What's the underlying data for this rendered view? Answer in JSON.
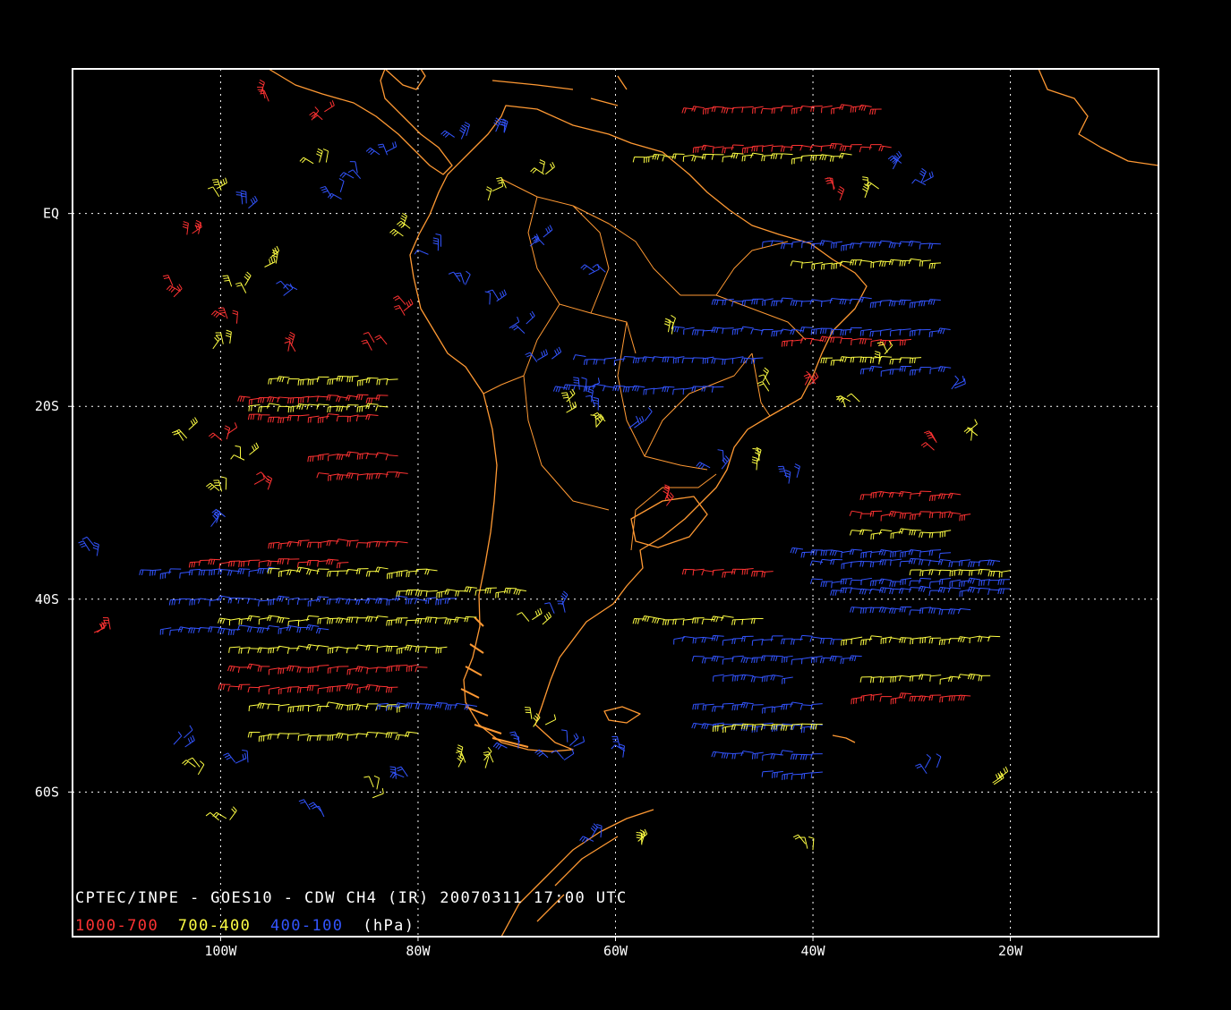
{
  "map": {
    "extent": {
      "lon_min": -115,
      "lon_max": -5,
      "lat_min": -75,
      "lat_max": 15
    },
    "grid": {
      "style": "dotted",
      "lon_step": 20,
      "lat_step": 20
    },
    "x_ticks": [
      {
        "lon": -100,
        "label": "100W"
      },
      {
        "lon": -80,
        "label": "80W"
      },
      {
        "lon": -60,
        "label": "60W"
      },
      {
        "lon": -40,
        "label": "40W"
      },
      {
        "lon": -20,
        "label": "20W"
      }
    ],
    "y_ticks": [
      {
        "lat": 0,
        "label": "EQ"
      },
      {
        "lat": -20,
        "label": "20S"
      },
      {
        "lat": -40,
        "label": "40S"
      },
      {
        "lat": -60,
        "label": "60S"
      }
    ],
    "colors": {
      "background": "#000000",
      "frame": "#ffffff",
      "grid": "#ffffff",
      "coastline": "#ff9933",
      "low_level": "#ff3333",
      "mid_level": "#ffff44",
      "high_level": "#3355ff",
      "title": "#ffffff"
    }
  },
  "title": "CPTEC/INPE - GOES10 - CDW CH4 (IR) 20070311 17:00 UTC",
  "legend": {
    "items": [
      {
        "label": "1000-700",
        "color": "#ff3333"
      },
      {
        "label": "700-400",
        "color": "#ffff44"
      },
      {
        "label": "400-100",
        "color": "#3355ff"
      }
    ],
    "unit": "(hPa)"
  },
  "wind_bands": [
    {
      "layer": "high",
      "lat": -12,
      "lon_start": -54,
      "lon_end": -27
    },
    {
      "layer": "high",
      "lat": -9,
      "lon_start": -50,
      "lon_end": -28
    },
    {
      "layer": "high",
      "lat": -3,
      "lon_start": -45,
      "lon_end": -28
    },
    {
      "layer": "mid",
      "lat": -5,
      "lon_start": -42,
      "lon_end": -28
    },
    {
      "layer": "high",
      "lat": -15,
      "lon_start": -64,
      "lon_end": -46
    },
    {
      "layer": "high",
      "lat": -18,
      "lon_start": -66,
      "lon_end": -50
    },
    {
      "layer": "mid",
      "lat": 6,
      "lon_start": -58,
      "lon_end": -37
    },
    {
      "layer": "low",
      "lat": 11,
      "lon_start": -53,
      "lon_end": -34
    },
    {
      "layer": "low",
      "lat": 7,
      "lon_start": -52,
      "lon_end": -33
    },
    {
      "layer": "mid",
      "lat": -17,
      "lon_start": -95,
      "lon_end": -83
    },
    {
      "layer": "low",
      "lat": -19,
      "lon_start": -98,
      "lon_end": -84
    },
    {
      "layer": "low",
      "lat": -21,
      "lon_start": -97,
      "lon_end": -85
    },
    {
      "layer": "mid",
      "lat": -20,
      "lon_start": -97,
      "lon_end": -84
    },
    {
      "layer": "low",
      "lat": -25,
      "lon_start": -91,
      "lon_end": -83
    },
    {
      "layer": "low",
      "lat": -27,
      "lon_start": -90,
      "lon_end": -82
    },
    {
      "layer": "low",
      "lat": -34,
      "lon_start": -95,
      "lon_end": -82
    },
    {
      "layer": "low",
      "lat": -36,
      "lon_start": -103,
      "lon_end": -88
    },
    {
      "layer": "high",
      "lat": -37,
      "lon_start": -108,
      "lon_end": -95
    },
    {
      "layer": "mid",
      "lat": -37,
      "lon_start": -95,
      "lon_end": -79
    },
    {
      "layer": "high",
      "lat": -40,
      "lon_start": -105,
      "lon_end": -77
    },
    {
      "layer": "mid",
      "lat": -39,
      "lon_start": -82,
      "lon_end": -70
    },
    {
      "layer": "mid",
      "lat": -42,
      "lon_start": -100,
      "lon_end": -75
    },
    {
      "layer": "high",
      "lat": -43,
      "lon_start": -106,
      "lon_end": -90
    },
    {
      "layer": "mid",
      "lat": -45,
      "lon_start": -99,
      "lon_end": -78
    },
    {
      "layer": "low",
      "lat": -47,
      "lon_start": -99,
      "lon_end": -80
    },
    {
      "layer": "low",
      "lat": -49,
      "lon_start": -100,
      "lon_end": -83
    },
    {
      "layer": "mid",
      "lat": -51,
      "lon_start": -97,
      "lon_end": -82
    },
    {
      "layer": "high",
      "lat": -51,
      "lon_start": -84,
      "lon_end": -75
    },
    {
      "layer": "mid",
      "lat": -54,
      "lon_start": -97,
      "lon_end": -81
    },
    {
      "layer": "high",
      "lat": -35,
      "lon_start": -42,
      "lon_end": -27
    },
    {
      "layer": "high",
      "lat": -36,
      "lon_start": -40,
      "lon_end": -22
    },
    {
      "layer": "high",
      "lat": -38,
      "lon_start": -40,
      "lon_end": -21
    },
    {
      "layer": "mid",
      "lat": -37,
      "lon_start": -30,
      "lon_end": -21
    },
    {
      "layer": "high",
      "lat": -39,
      "lon_start": -38,
      "lon_end": -21
    },
    {
      "layer": "high",
      "lat": -41,
      "lon_start": -36,
      "lon_end": -25
    },
    {
      "layer": "mid",
      "lat": -42,
      "lon_start": -58,
      "lon_end": -46
    },
    {
      "layer": "high",
      "lat": -44,
      "lon_start": -54,
      "lon_end": -38
    },
    {
      "layer": "mid",
      "lat": -44,
      "lon_start": -37,
      "lon_end": -22
    },
    {
      "layer": "high",
      "lat": -46,
      "lon_start": -52,
      "lon_end": -36
    },
    {
      "layer": "high",
      "lat": -48,
      "lon_start": -50,
      "lon_end": -43
    },
    {
      "layer": "mid",
      "lat": -48,
      "lon_start": -35,
      "lon_end": -23
    },
    {
      "layer": "low",
      "lat": -50,
      "lon_start": -36,
      "lon_end": -25
    },
    {
      "layer": "high",
      "lat": -51,
      "lon_start": -52,
      "lon_end": -40
    },
    {
      "layer": "high",
      "lat": -53,
      "lon_start": -52,
      "lon_end": -40
    },
    {
      "layer": "mid",
      "lat": -53,
      "lon_start": -50,
      "lon_end": -40
    },
    {
      "layer": "high",
      "lat": -56,
      "lon_start": -50,
      "lon_end": -40
    },
    {
      "layer": "high",
      "lat": -58,
      "lon_start": -45,
      "lon_end": -40
    },
    {
      "layer": "low",
      "lat": -31,
      "lon_start": -36,
      "lon_end": -25
    },
    {
      "layer": "low",
      "lat": -29,
      "lon_start": -35,
      "lon_end": -26
    },
    {
      "layer": "mid",
      "lat": -33,
      "lon_start": -36,
      "lon_end": -27
    },
    {
      "layer": "low",
      "lat": -37,
      "lon_start": -53,
      "lon_end": -45
    },
    {
      "layer": "mid",
      "lat": -15,
      "lon_start": -39,
      "lon_end": -30
    },
    {
      "layer": "low",
      "lat": -13,
      "lon_start": -43,
      "lon_end": -31
    },
    {
      "layer": "high",
      "lat": -16,
      "lon_start": -35,
      "lon_end": -27
    }
  ],
  "wind_scatter": [
    {
      "layer": "high",
      "lat": 2,
      "lon": -88
    },
    {
      "layer": "high",
      "lat": 4,
      "lon": -86
    },
    {
      "layer": "high",
      "lat": 6,
      "lon": -84
    },
    {
      "layer": "mid",
      "lat": 5,
      "lon": -90
    },
    {
      "layer": "low",
      "lat": 10,
      "lon": -90
    },
    {
      "layer": "low",
      "lat": 12,
      "lon": -95
    },
    {
      "layer": "mid",
      "lat": 2,
      "lon": -100
    },
    {
      "layer": "high",
      "lat": 1,
      "lon": -97
    },
    {
      "layer": "low",
      "lat": -2,
      "lon": -103
    },
    {
      "layer": "mid",
      "lat": -5,
      "lon": -95
    },
    {
      "layer": "low",
      "lat": -8,
      "lon": -104
    },
    {
      "layer": "mid",
      "lat": -8,
      "lon": -98
    },
    {
      "layer": "high",
      "lat": -8,
      "lon": -93
    },
    {
      "layer": "low",
      "lat": -11,
      "lon": -99
    },
    {
      "layer": "mid",
      "lat": -14,
      "lon": -100
    },
    {
      "layer": "low",
      "lat": -14,
      "lon": -93
    },
    {
      "layer": "high",
      "lat": -4,
      "lon": -78
    },
    {
      "layer": "high",
      "lat": -7,
      "lon": -76
    },
    {
      "layer": "high",
      "lat": -9,
      "lon": -72
    },
    {
      "layer": "high",
      "lat": -12,
      "lon": -70
    },
    {
      "layer": "high",
      "lat": -15,
      "lon": -67
    },
    {
      "layer": "high",
      "lat": -18,
      "lon": -63
    },
    {
      "layer": "mid",
      "lat": -20,
      "lon": -64
    },
    {
      "layer": "high",
      "lat": -22,
      "lon": -58
    },
    {
      "layer": "mid",
      "lat": -22,
      "lon": -62
    },
    {
      "layer": "mid",
      "lat": -12,
      "lon": -54
    },
    {
      "layer": "high",
      "lat": -6,
      "lon": -62
    },
    {
      "layer": "high",
      "lat": -3,
      "lon": -68
    },
    {
      "layer": "mid",
      "lat": 2,
      "lon": -72
    },
    {
      "layer": "mid",
      "lat": 4,
      "lon": -68
    },
    {
      "layer": "high",
      "lat": 8,
      "lon": -76
    },
    {
      "layer": "high",
      "lat": 9,
      "lon": -72
    },
    {
      "layer": "mid",
      "lat": -2,
      "lon": -81
    },
    {
      "layer": "low",
      "lat": -10,
      "lon": -82
    },
    {
      "layer": "low",
      "lat": -14,
      "lon": -84
    },
    {
      "layer": "mid",
      "lat": -18,
      "lon": -45
    },
    {
      "layer": "low",
      "lat": -18,
      "lon": -40
    },
    {
      "layer": "mid",
      "lat": -20,
      "lon": -36
    },
    {
      "layer": "low",
      "lat": -24,
      "lon": -28
    },
    {
      "layer": "mid",
      "lat": -23,
      "lon": -24
    },
    {
      "layer": "high",
      "lat": -18,
      "lon": -25
    },
    {
      "layer": "mid",
      "lat": -15,
      "lon": -33
    },
    {
      "layer": "high",
      "lat": 5,
      "lon": -32
    },
    {
      "layer": "high",
      "lat": 3,
      "lon": -29
    },
    {
      "layer": "mid",
      "lat": 2,
      "lon": -34
    },
    {
      "layer": "low",
      "lat": 2,
      "lon": -38
    },
    {
      "layer": "high",
      "lat": -26,
      "lon": -50
    },
    {
      "layer": "mid",
      "lat": -26,
      "lon": -45
    },
    {
      "layer": "high",
      "lat": -28,
      "lon": -42
    },
    {
      "layer": "low",
      "lat": -30,
      "lon": -55
    },
    {
      "layer": "mid",
      "lat": -42,
      "lon": -68
    },
    {
      "layer": "high",
      "lat": -41,
      "lon": -66
    },
    {
      "layer": "mid",
      "lat": -53,
      "lon": -68
    },
    {
      "layer": "high",
      "lat": -55,
      "lon": -70
    },
    {
      "layer": "high",
      "lat": -55,
      "lon": -65
    },
    {
      "layer": "high",
      "lat": -56,
      "lon": -60
    },
    {
      "layer": "mid",
      "lat": -57,
      "lon": -76
    },
    {
      "layer": "mid",
      "lat": -57,
      "lon": -73
    },
    {
      "layer": "high",
      "lat": -57,
      "lon": -66
    },
    {
      "layer": "mid",
      "lat": -58,
      "lon": -103
    },
    {
      "layer": "high",
      "lat": -55,
      "lon": -104
    },
    {
      "layer": "high",
      "lat": -57,
      "lon": -98
    },
    {
      "layer": "mid",
      "lat": -63,
      "lon": -100
    },
    {
      "layer": "high",
      "lat": -62,
      "lon": -90
    },
    {
      "layer": "mid",
      "lat": -60,
      "lon": -85
    },
    {
      "layer": "high",
      "lat": -58,
      "lon": -82
    },
    {
      "layer": "mid",
      "lat": -65,
      "lon": -58
    },
    {
      "layer": "high",
      "lat": -65,
      "lon": -62
    },
    {
      "layer": "mid",
      "lat": -66,
      "lon": -40
    },
    {
      "layer": "high",
      "lat": -58,
      "lon": -28
    },
    {
      "layer": "mid",
      "lat": -59,
      "lon": -22
    },
    {
      "layer": "high",
      "lat": -35,
      "lon": -113
    },
    {
      "layer": "low",
      "lat": -43,
      "lon": -112
    },
    {
      "layer": "high",
      "lat": -32,
      "lon": -100
    },
    {
      "layer": "mid",
      "lat": -29,
      "lon": -100
    },
    {
      "layer": "low",
      "lat": -28,
      "lon": -96
    },
    {
      "layer": "mid",
      "lat": -23,
      "lon": -103
    },
    {
      "layer": "low",
      "lat": -23,
      "lon": -100
    },
    {
      "layer": "mid",
      "lat": -25,
      "lon": -97
    },
    {
      "layer": "high",
      "lat": -20,
      "lon": -62
    }
  ]
}
